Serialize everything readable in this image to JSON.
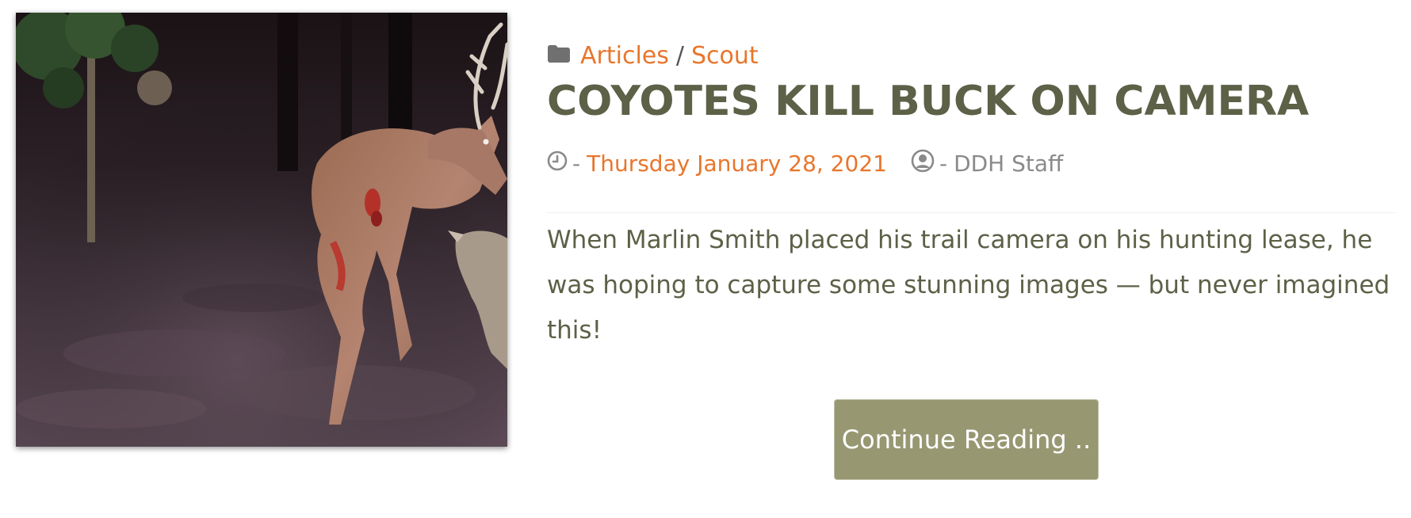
{
  "post": {
    "image_alt": "Trail camera photo of a wounded buck with a coyote at night",
    "categories": [
      "Articles",
      "Scout"
    ],
    "category_separator": "/",
    "title": "COYOTES KILL BUCK ON CAMERA",
    "meta_dash": "-",
    "date": "Thursday January 28, 2021",
    "author": "DDH Staff",
    "excerpt": "When Marlin Smith placed his trail camera on his hunting lease, he was hoping to capture some stunning images — but never imagined this!",
    "continue_label": "Continue Reading .."
  },
  "icons": {
    "category": "folder-icon",
    "date": "clock-icon",
    "author": "user-circle-icon"
  },
  "colors": {
    "link": "#e8762c",
    "title": "#5c6147",
    "text": "#5c6147",
    "muted": "#8a8a8a",
    "button_bg": "#979872",
    "button_text": "#ffffff"
  }
}
